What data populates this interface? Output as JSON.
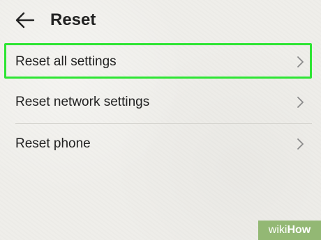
{
  "header": {
    "title": "Reset",
    "back_icon": "arrow-left-icon"
  },
  "items": [
    {
      "label": "Reset all settings",
      "highlighted": true,
      "highlight_color": "#2ee534"
    },
    {
      "label": "Reset network settings"
    },
    {
      "label": "Reset phone"
    }
  ],
  "colors": {
    "background": "#efeeea",
    "text": "#222222",
    "chevron": "#8a8a8a",
    "highlight": "#2ee534"
  },
  "watermark": {
    "wiki": "wiki",
    "how": "How"
  }
}
